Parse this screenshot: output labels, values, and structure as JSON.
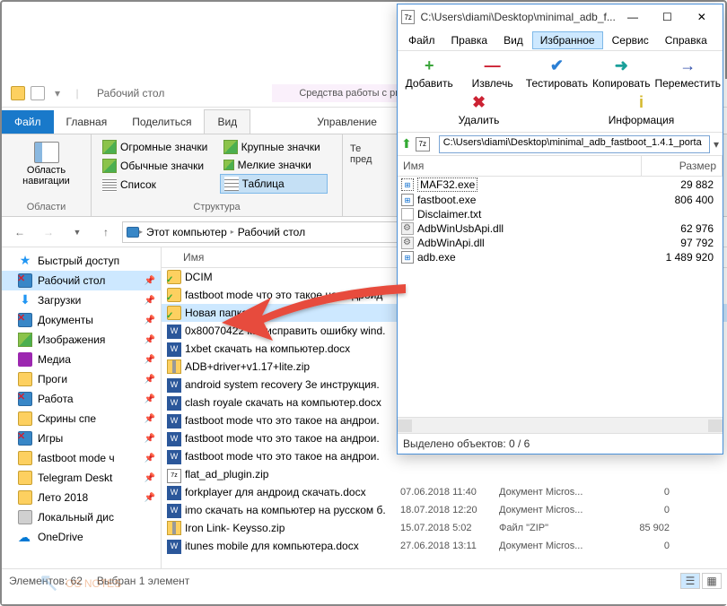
{
  "explorer": {
    "title": "Рабочий стол",
    "ribbon_context_group": "Средства работы с рисунками",
    "tabs": {
      "file": "Файл",
      "home": "Главная",
      "share": "Поделиться",
      "view": "Вид",
      "manage": "Управление"
    },
    "ribbon": {
      "nav_pane": "Область навигации",
      "section_panes": "Области",
      "huge": "Огромные значки",
      "large": "Крупные значки",
      "normal": "Обычные значки",
      "small": "Мелкие значки",
      "list": "Список",
      "table": "Таблица",
      "section_layout": "Структура",
      "cur_view_prefix": "Те\nпред"
    },
    "breadcrumb": {
      "root": "Этот компьютер",
      "leaf": "Рабочий стол"
    },
    "list_header": {
      "name": "Имя"
    },
    "sidebar": [
      {
        "icon": "star",
        "label": "Быстрый доступ"
      },
      {
        "icon": "monitor",
        "label": "Рабочий стол",
        "pinned": true,
        "selected": true,
        "xover": true
      },
      {
        "icon": "dl",
        "label": "Загрузки",
        "pinned": true
      },
      {
        "icon": "doc",
        "label": "Документы",
        "pinned": true,
        "xover": true
      },
      {
        "icon": "img",
        "label": "Изображения",
        "pinned": true
      },
      {
        "icon": "media",
        "label": "Медиа",
        "pinned": true
      },
      {
        "icon": "folder",
        "label": "Проги",
        "pinned": true
      },
      {
        "icon": "folder",
        "label": "Работа",
        "pinned": true,
        "xover": true
      },
      {
        "icon": "folder",
        "label": "Скрины спе",
        "pinned": true
      },
      {
        "icon": "folder",
        "label": "Игры",
        "pinned": true,
        "xover": true
      },
      {
        "icon": "folder",
        "label": "fastboot mode ч",
        "pinned": true
      },
      {
        "icon": "folder",
        "label": "Telegram Deskt",
        "pinned": true
      },
      {
        "icon": "folder",
        "label": "Лето 2018",
        "pinned": true
      },
      {
        "icon": "disk",
        "label": "Локальный дис"
      },
      {
        "icon": "cloud",
        "label": "OneDrive"
      }
    ],
    "files": [
      {
        "icon": "folder-check",
        "name": "DCIM"
      },
      {
        "icon": "folder-check",
        "name": "fastboot mode что это такое на андроид"
      },
      {
        "icon": "folder-check",
        "name": "Новая папка",
        "selected": true
      },
      {
        "icon": "word",
        "name": "0x80070422 как исправить ошибку wind."
      },
      {
        "icon": "word",
        "name": "1xbet скачать на компьютер.docx"
      },
      {
        "icon": "zip",
        "name": "ADB+driver+v1.17+lite.zip"
      },
      {
        "icon": "word",
        "name": "android system recovery 3e инструкция."
      },
      {
        "icon": "word",
        "name": "clash royale скачать на компьютер.docx"
      },
      {
        "icon": "word",
        "name": "fastboot mode что это такое на андрои."
      },
      {
        "icon": "word",
        "name": "fastboot mode что это такое на андрои."
      },
      {
        "icon": "word",
        "name": "fastboot mode что это такое на андрои."
      },
      {
        "icon": "7z",
        "name": "flat_ad_plugin.zip"
      },
      {
        "icon": "word",
        "name": "forkplayer для андроид скачать.docx",
        "date": "07.06.2018 11:40",
        "type": "Документ Micros...",
        "size": "0"
      },
      {
        "icon": "word",
        "name": "imo скачать на компьютер на русском б.",
        "date": "18.07.2018 12:20",
        "type": "Документ Micros...",
        "size": "0"
      },
      {
        "icon": "zip",
        "name": "Iron Link- Keysso.zip",
        "date": "15.07.2018 5:02",
        "type": "Файл \"ZIP\"",
        "size": "85 902"
      },
      {
        "icon": "word",
        "name": "itunes mobile для компьютера.docx",
        "date": "27.06.2018 13:11",
        "type": "Документ Micros...",
        "size": "0"
      }
    ],
    "status": {
      "count": "Элементов: 62",
      "sel": "Выбран 1 элемент"
    }
  },
  "sevenzip": {
    "title": "C:\\Users\\diami\\Desktop\\minimal_adb_f...",
    "menu": [
      "Файл",
      "Правка",
      "Вид",
      "Избранное",
      "Сервис",
      "Справка"
    ],
    "menu_highlight": 3,
    "toolbar": [
      {
        "icon": "+",
        "label": "Добавить",
        "color": "#3aa53a"
      },
      {
        "icon": "—",
        "label": "Извлечь",
        "color": "#c23"
      },
      {
        "icon": "✔",
        "label": "Тестировать",
        "color": "#2b7fd4"
      },
      {
        "icon": "➜",
        "label": "Копировать",
        "color": "#1aa09a"
      },
      {
        "icon": "→",
        "label": "Переместить",
        "color": "#2b4aa8"
      },
      {
        "icon": "✖",
        "label": "Удалить",
        "color": "#c23"
      },
      {
        "icon": "i",
        "label": "Информация",
        "color": "#d4b82b"
      }
    ],
    "path": "C:\\Users\\diami\\Desktop\\minimal_adb_fastboot_1.4.1_porta",
    "pathicon": "7z",
    "cols": {
      "name": "Имя",
      "size": "Размер"
    },
    "rows": [
      {
        "name": "MAF32.exe",
        "size": "29 882",
        "icon": "exe",
        "selected": true
      },
      {
        "name": "fastboot.exe",
        "size": "806 400",
        "icon": "exe"
      },
      {
        "name": "Disclaimer.txt",
        "size": "",
        "icon": "txt"
      },
      {
        "name": "AdbWinUsbApi.dll",
        "size": "62 976",
        "icon": "dll"
      },
      {
        "name": "AdbWinApi.dll",
        "size": "97 792",
        "icon": "dll"
      },
      {
        "name": "adb.exe",
        "size": "1 489 920",
        "icon": "exe"
      }
    ],
    "status": "Выделено объектов: 0 / 6"
  },
  "watermark": "OS NOTES"
}
